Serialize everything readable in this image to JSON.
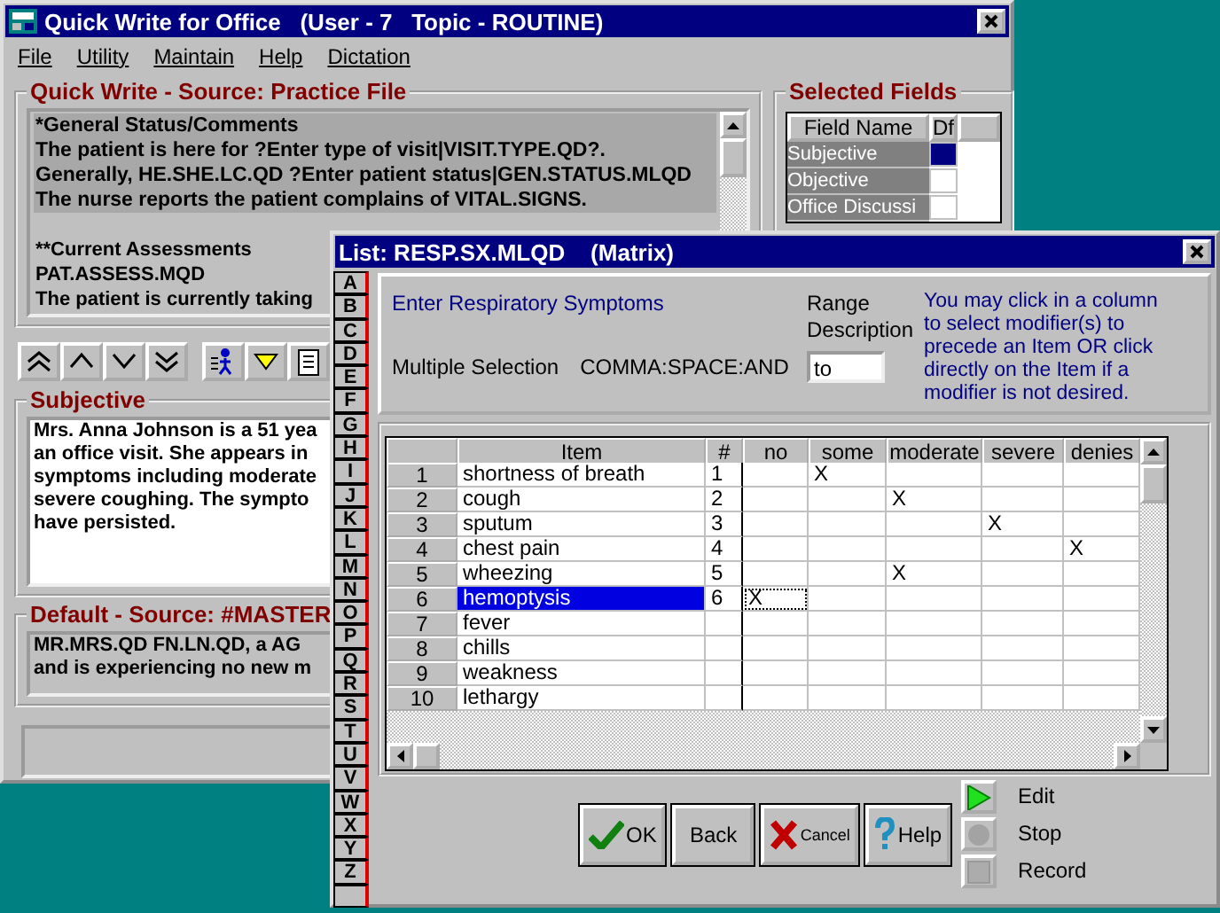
{
  "main_window": {
    "title": "Quick Write for Office   (User - 7   Topic - ROUTINE)",
    "menu": [
      "File",
      "Utility",
      "Maintain",
      "Help",
      "Dictation"
    ],
    "quick_write": {
      "label": "Quick Write - Source: Practice File",
      "sections": [
        {
          "highlighted": true,
          "lines": [
            "*General Status/Comments",
            "The patient is here for ?Enter type of visit|VISIT.TYPE.QD?.",
            "Generally, HE.SHE.LC.QD ?Enter patient status|GEN.STATUS.MLQD",
            "The nurse reports the patient complains of VITAL.SIGNS."
          ]
        },
        {
          "highlighted": false,
          "lines": [
            "**Current Assessments",
            "PAT.ASSESS.MQD",
            "The patient is currently taking"
          ]
        }
      ]
    },
    "selected_fields": {
      "label": "Selected Fields",
      "columns": [
        "Field Name",
        "Df"
      ],
      "rows": [
        {
          "name": "Subjective",
          "df": true
        },
        {
          "name": "Objective",
          "df": false
        },
        {
          "name": "Office Discussi",
          "df": false
        }
      ]
    },
    "subjective": {
      "label": "Subjective",
      "lines": [
        "Mrs. Anna Johnson is a 51 yea",
        "an office visit. She appears in",
        "symptoms including moderate",
        "severe coughing. The sympto",
        "have persisted."
      ]
    },
    "default": {
      "label": "Default - Source: #MASTER",
      "lines": [
        "MR.MRS.QD FN.LN.QD, a AG",
        "and is experiencing no new m"
      ]
    }
  },
  "dialog": {
    "title": "List: RESP.SX.MLQD    (Matrix)",
    "tabs": [
      "A",
      "B",
      "C",
      "D",
      "E",
      "F",
      "G",
      "H",
      "I",
      "J",
      "K",
      "L",
      "M",
      "N",
      "O",
      "P",
      "Q",
      "R",
      "S",
      "T",
      "U",
      "V",
      "W",
      "X",
      "Y",
      "Z"
    ],
    "prompt": "Enter Respiratory Symptoms",
    "multiple_selection_label": "Multiple Selection",
    "multiple_selection_value": "COMMA:SPACE:AND",
    "range_label": "Range Description",
    "range_value": "to",
    "help_text": "You may click in a column to select modifier(s) to precede an Item OR click directly on the Item if a modifier is not desired.",
    "grid": {
      "columns": {
        "item": "Item",
        "count": "#",
        "modifiers": [
          "no",
          "some",
          "moderate",
          "severe",
          "denies"
        ]
      },
      "rows": [
        {
          "number": "1",
          "item": "shortness of breath",
          "count": "1",
          "selected": false,
          "cells": [
            {
              "focused": false
            },
            {
              "text": "X",
              "focused": false
            },
            {
              "focused": false
            },
            {
              "focused": false
            },
            {
              "focused": false
            }
          ]
        },
        {
          "number": "2",
          "item": "cough",
          "count": "2",
          "selected": false,
          "cells": [
            {
              "focused": false
            },
            {
              "focused": false
            },
            {
              "text": "X",
              "focused": false
            },
            {
              "focused": false
            },
            {
              "focused": false
            }
          ]
        },
        {
          "number": "3",
          "item": "sputum",
          "count": "3",
          "selected": false,
          "cells": [
            {
              "focused": false
            },
            {
              "focused": false
            },
            {
              "focused": false
            },
            {
              "text": "X",
              "focused": false
            },
            {
              "focused": false
            }
          ]
        },
        {
          "number": "4",
          "item": "chest pain",
          "count": "4",
          "selected": false,
          "cells": [
            {
              "focused": false
            },
            {
              "focused": false
            },
            {
              "focused": false
            },
            {
              "focused": false
            },
            {
              "text": "X",
              "focused": false
            }
          ]
        },
        {
          "number": "5",
          "item": "wheezing",
          "count": "5",
          "selected": false,
          "cells": [
            {
              "focused": false
            },
            {
              "focused": false
            },
            {
              "text": "X",
              "focused": false
            },
            {
              "focused": false
            },
            {
              "focused": false
            }
          ]
        },
        {
          "number": "6",
          "item": "hemoptysis",
          "count": "6",
          "selected": true,
          "cells": [
            {
              "text": "X",
              "focused": true
            },
            {
              "focused": false
            },
            {
              "focused": false
            },
            {
              "focused": false
            },
            {
              "focused": false
            }
          ]
        },
        {
          "number": "7",
          "item": "fever",
          "selected": false,
          "cells": [
            {
              "focused": false
            },
            {
              "focused": false
            },
            {
              "focused": false
            },
            {
              "focused": false
            },
            {
              "focused": false
            }
          ]
        },
        {
          "number": "8",
          "item": "chills",
          "selected": false,
          "cells": [
            {
              "focused": false
            },
            {
              "focused": false
            },
            {
              "focused": false
            },
            {
              "focused": false
            },
            {
              "focused": false
            }
          ]
        },
        {
          "number": "9",
          "item": "weakness",
          "selected": false,
          "cells": [
            {
              "focused": false
            },
            {
              "focused": false
            },
            {
              "focused": false
            },
            {
              "focused": false
            },
            {
              "focused": false
            }
          ]
        },
        {
          "number": "10",
          "item": "lethargy",
          "selected": false,
          "cells": [
            {
              "focused": false
            },
            {
              "focused": false
            },
            {
              "focused": false
            },
            {
              "focused": false
            },
            {
              "focused": false
            }
          ]
        }
      ]
    },
    "buttons": [
      {
        "kind": "ok",
        "label": "OK"
      },
      {
        "kind": "back",
        "label": "Back"
      },
      {
        "kind": "cancel",
        "label": "Cancel"
      },
      {
        "kind": "help",
        "label": "Help"
      }
    ],
    "media": [
      {
        "kind": "play",
        "label": "Edit",
        "disabled": false
      },
      {
        "kind": "stop",
        "label": "Stop",
        "disabled": true
      },
      {
        "kind": "record",
        "label": "Record",
        "disabled": true
      }
    ]
  }
}
